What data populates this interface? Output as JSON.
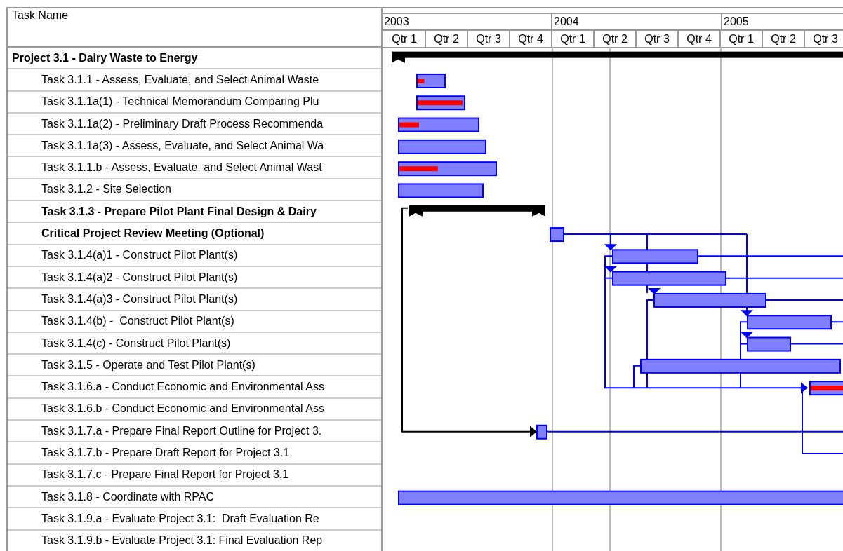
{
  "columns": {
    "task_name": "Task Name"
  },
  "timescale": {
    "years": [
      "2003",
      "2004",
      "2005"
    ],
    "quarters": [
      "Qtr 1",
      "Qtr 2",
      "Qtr 3",
      "Qtr 4",
      "Qtr 1",
      "Qtr 2",
      "Qtr 3",
      "Qtr 4",
      "Qtr 1",
      "Qtr 2",
      "Qtr 3"
    ]
  },
  "tasks": [
    {
      "name": "Project 3.1 - Dairy Waste to Energy",
      "kind": "summary"
    },
    {
      "name": "Task 3.1.1 - Assess, Evaluate, and Select Animal Waste",
      "kind": "task",
      "level": 0.25
    },
    {
      "name": "Task 3.1.1a(1) - Technical Memorandum Comparing Plu",
      "kind": "task",
      "level": 0.97
    },
    {
      "name": "Task 3.1.1a(2) - Preliminary Draft Process Recommenda",
      "kind": "task",
      "level": 0.25
    },
    {
      "name": "Task 3.1.1a(3) - Assess, Evaluate, and Select Animal Wa",
      "kind": "task"
    },
    {
      "name": "Task 3.1.1.b - Assess, Evaluate, and Select Animal Wast",
      "kind": "task",
      "level": 0.4
    },
    {
      "name": "Task 3.1.2 - Site Selection",
      "kind": "task"
    },
    {
      "name": "Task 3.1.3 - Prepare Pilot Plant Final Design & Dairy",
      "kind": "summary"
    },
    {
      "name": "Critical Project Review Meeting (Optional)",
      "kind": "milestone"
    },
    {
      "name": "Task 3.1.4(a)1 - Construct Pilot Plant(s)",
      "kind": "task"
    },
    {
      "name": "Task 3.1.4(a)2 - Construct Pilot Plant(s)",
      "kind": "task"
    },
    {
      "name": "Task 3.1.4(a)3 - Construct Pilot Plant(s)",
      "kind": "task"
    },
    {
      "name": "Task 3.1.4(b) -  Construct Pilot Plant(s)",
      "kind": "task"
    },
    {
      "name": "Task 3.1.4(c) - Construct Pilot Plant(s)",
      "kind": "task"
    },
    {
      "name": "Task 3.1.5 - Operate and Test Pilot Plant(s)",
      "kind": "task"
    },
    {
      "name": "Task 3.1.6.a - Conduct Economic and Environmental Ass",
      "kind": "task",
      "level": 1
    },
    {
      "name": "Task 3.1.6.b - Conduct Economic and Environmental Ass",
      "kind": "task"
    },
    {
      "name": "Task 3.1.7.a - Prepare Final Report Outline for Project 3.",
      "kind": "task"
    },
    {
      "name": "Task 3.1.7.b - Prepare Draft Report for Project 3.1",
      "kind": "task"
    },
    {
      "name": "Task 3.1.7.c - Prepare Final Report for Project 3.1",
      "kind": "task"
    },
    {
      "name": "Task 3.1.8 - Coordinate with RPAC",
      "kind": "task"
    },
    {
      "name": "Task 3.1.9.a - Evaluate Project 3.1:  Draft Evaluation Re",
      "kind": "task"
    },
    {
      "name": "Task 3.1.9.b - Evaluate Project 3.1: Final Evaluation Rep",
      "kind": "task"
    }
  ]
}
